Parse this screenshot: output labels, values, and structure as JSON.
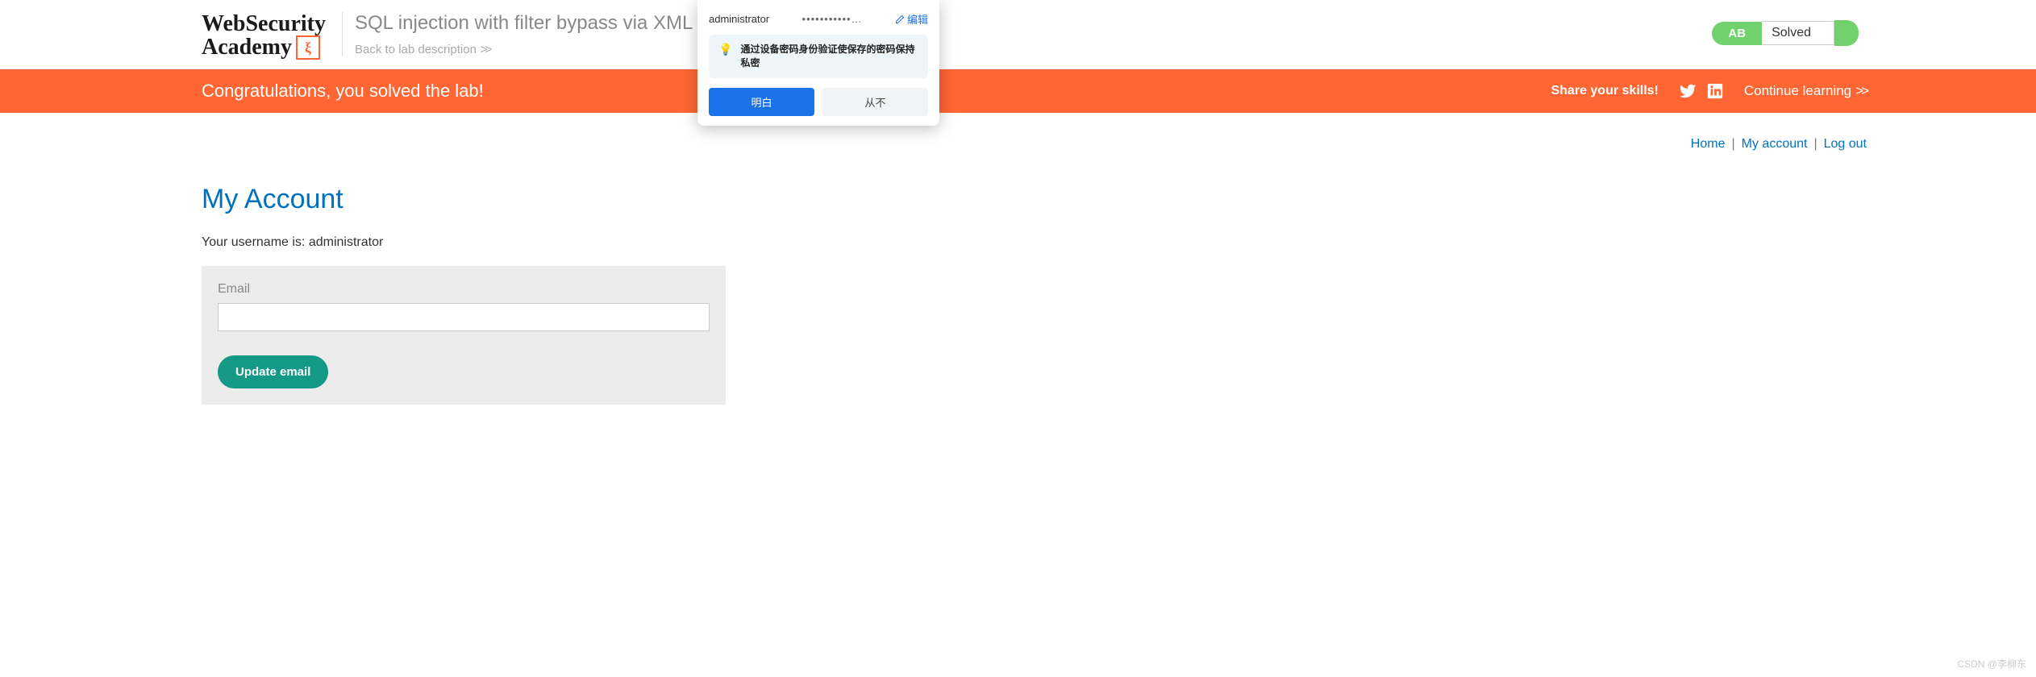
{
  "logo": {
    "line1": "WebSecurity",
    "line2": "Academy"
  },
  "header": {
    "lab_title": "SQL injection with filter bypass via XML e",
    "back_link": "Back to lab description"
  },
  "lab_status": {
    "prefix": "AB",
    "state": "Solved"
  },
  "popup": {
    "username": "administrator",
    "password_masked": "•••••••••••…",
    "edit_label": "编辑",
    "message": "通过设备密码身份验证使保存的密码保持私密",
    "btn_ok": "明白",
    "btn_never": "从不"
  },
  "orange": {
    "congrats": "Congratulations, you solved the lab!",
    "share": "Share your skills!",
    "continue": "Continue learning"
  },
  "nav": {
    "home": "Home",
    "account": "My account",
    "logout": "Log out"
  },
  "account": {
    "title": "My Account",
    "username_label": "Your username is: ",
    "username": "administrator",
    "email_label": "Email",
    "update_btn": "Update email"
  },
  "watermark": "CSDN @李柳东"
}
